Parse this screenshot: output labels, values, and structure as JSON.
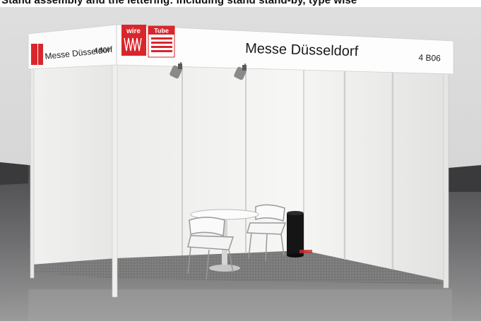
{
  "caption": "Stand assembly and the lettering: including stand stand-by, type wise",
  "booth": {
    "fascia_name_front": "Messe Düsseldorf",
    "fascia_number_front": "4 B06",
    "fascia_name_side": "Messe Düsseldorf",
    "fascia_number_side": "4 B06"
  },
  "logos": {
    "wire": "wire",
    "tube": "Tube"
  },
  "colors": {
    "logo_red": "#d9262c",
    "floor_carpet": "#7d7d7d",
    "wall_white": "#f4f4f2",
    "hall_dark": "#3a3a3c"
  }
}
